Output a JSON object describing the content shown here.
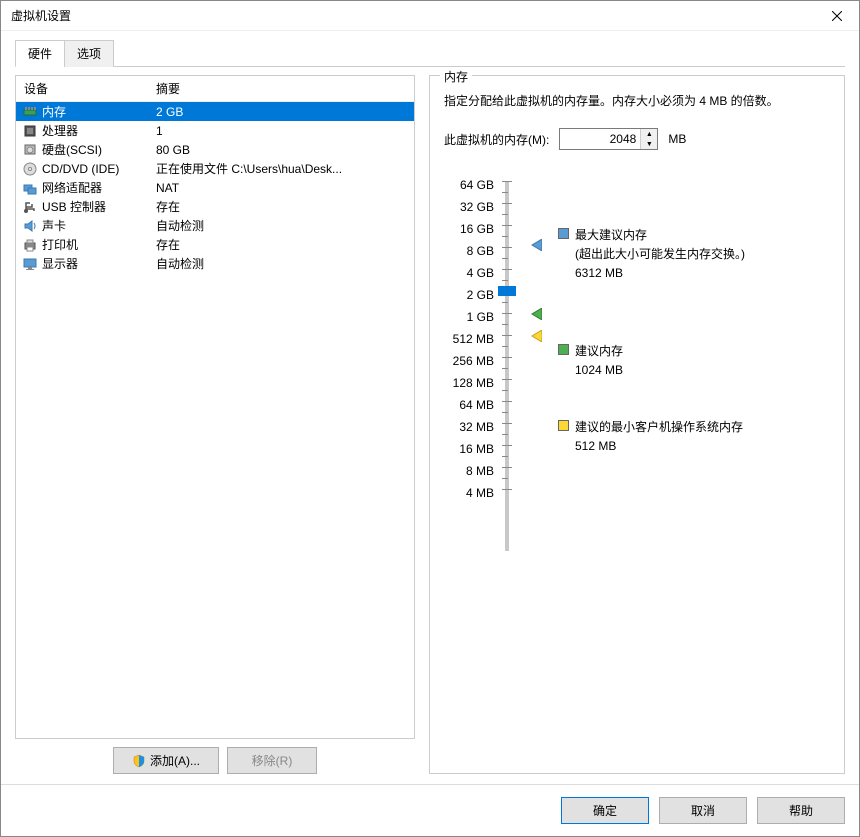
{
  "window": {
    "title": "虚拟机设置"
  },
  "tabs": {
    "hardware": "硬件",
    "options": "选项"
  },
  "device_list": {
    "header_device": "设备",
    "header_summary": "摘要",
    "items": [
      {
        "name": "内存",
        "summary": "2 GB",
        "icon": "memory"
      },
      {
        "name": "处理器",
        "summary": "1",
        "icon": "cpu"
      },
      {
        "name": "硬盘(SCSI)",
        "summary": "80 GB",
        "icon": "disk"
      },
      {
        "name": "CD/DVD (IDE)",
        "summary": "正在使用文件 C:\\Users\\hua\\Desk...",
        "icon": "cd"
      },
      {
        "name": "网络适配器",
        "summary": "NAT",
        "icon": "net"
      },
      {
        "name": "USB 控制器",
        "summary": "存在",
        "icon": "usb"
      },
      {
        "name": "声卡",
        "summary": "自动检测",
        "icon": "sound"
      },
      {
        "name": "打印机",
        "summary": "存在",
        "icon": "printer"
      },
      {
        "name": "显示器",
        "summary": "自动检测",
        "icon": "display"
      }
    ],
    "add_button": "添加(A)...",
    "remove_button": "移除(R)"
  },
  "memory_panel": {
    "group_label": "内存",
    "instruction": "指定分配给此虚拟机的内存量。内存大小必须为 4 MB 的倍数。",
    "input_label": "此虚拟机的内存(M):",
    "input_value": "2048",
    "input_unit": "MB",
    "ticks": [
      "64 GB",
      "32 GB",
      "16 GB",
      "8 GB",
      "4 GB",
      "2 GB",
      "1 GB",
      "512 MB",
      "256 MB",
      "128 MB",
      "64 MB",
      "32 MB",
      "16 MB",
      "8 MB",
      "4 MB"
    ],
    "legends": {
      "max": {
        "title": "最大建议内存",
        "sub": "(超出此大小可能发生内存交换。)",
        "value": "6312 MB"
      },
      "recommended": {
        "title": "建议内存",
        "value": "1024 MB"
      },
      "min": {
        "title": "建议的最小客户机操作系统内存",
        "value": "512 MB"
      }
    }
  },
  "footer": {
    "ok": "确定",
    "cancel": "取消",
    "help": "帮助"
  }
}
